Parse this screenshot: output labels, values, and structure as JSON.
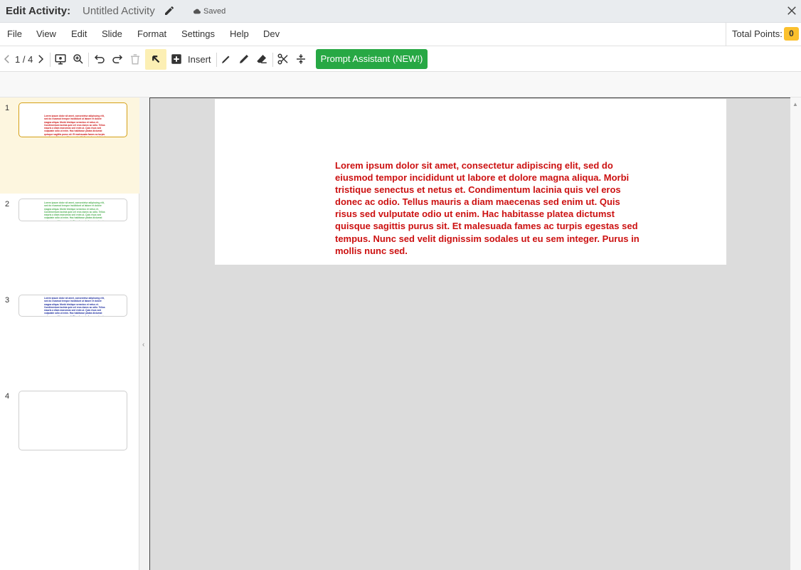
{
  "titlebar": {
    "label": "Edit Activity:",
    "activity_name": "Untitled Activity",
    "saved_status": "Saved"
  },
  "menu": {
    "items": [
      "File",
      "View",
      "Edit",
      "Slide",
      "Format",
      "Settings",
      "Help",
      "Dev"
    ],
    "total_points_label": "Total Points:",
    "total_points_value": "0"
  },
  "toolbar": {
    "page_indicator": "1 / 4",
    "insert_label": "Insert",
    "prompt_button_label": "Prompt Assistant (NEW!)",
    "icons": [
      "chevron-left-icon",
      "chevron-right-icon",
      "preview-icon",
      "zoom-icon",
      "undo-icon",
      "redo-icon",
      "trash-icon",
      "select-arrow-icon",
      "add-box-icon",
      "pen-icon",
      "marker-icon",
      "eraser-icon",
      "scissors-icon",
      "split-icon"
    ]
  },
  "slides": [
    {
      "number": "1",
      "active": true,
      "color": "#cc1111"
    },
    {
      "number": "2",
      "active": false,
      "color": "#4caf50"
    },
    {
      "number": "3",
      "active": false,
      "color": "#1a2a9e"
    },
    {
      "number": "4",
      "active": false,
      "color": ""
    }
  ],
  "slide_content": {
    "text": "Lorem ipsum dolor sit amet, consectetur adipiscing elit, sed do eiusmod tempor incididunt ut labore et dolore magna aliqua. Morbi tristique senectus et netus et. Condimentum lacinia quis vel eros donec ac odio. Tellus mauris a diam maecenas sed enim ut. Quis risus sed vulputate odio ut enim. Hac habitasse platea dictumst quisque sagittis purus sit. Et malesuada fames ac turpis egestas sed tempus. Nunc sed velit dignissim sodales ut eu sem integer. Purus in mollis nunc sed.",
    "text_color": "#cc1111"
  },
  "colors": {
    "accent_button": "#27a844",
    "points_badge": "#fbc02d",
    "active_tool": "#fcefb4",
    "active_slide_bg": "#fdf6df"
  }
}
